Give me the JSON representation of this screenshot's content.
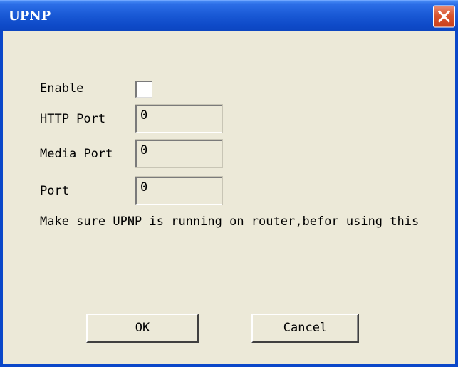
{
  "window": {
    "title": "UPNP",
    "close_label": "close"
  },
  "form": {
    "enable_label": "Enable",
    "enable_checked": false,
    "http_port_label": "HTTP Port",
    "http_port_value": "0",
    "media_port_label": "Media Port",
    "media_port_value": "0",
    "port_label": "Port",
    "port_value": "0",
    "note": "Make sure UPNP is running on router,befor using this"
  },
  "buttons": {
    "ok_label": "OK",
    "cancel_label": "Cancel"
  },
  "colors": {
    "titlebar": "#0a47c9",
    "background": "#ece9d8",
    "close_button": "#d9552f"
  },
  "icons": {
    "close": "close-icon"
  }
}
